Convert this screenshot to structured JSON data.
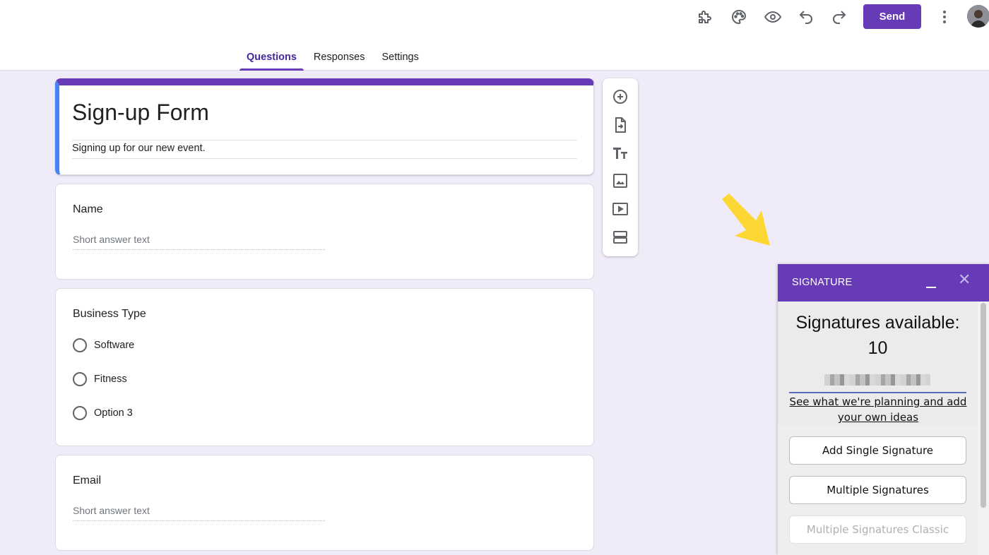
{
  "header": {
    "icons": [
      "addons-icon",
      "palette-icon",
      "preview-eye-icon",
      "undo-icon",
      "redo-icon",
      "more-vert-icon"
    ],
    "send_label": "Send"
  },
  "tabs": [
    {
      "label": "Questions",
      "active": true
    },
    {
      "label": "Responses",
      "active": false
    },
    {
      "label": "Settings",
      "active": false
    }
  ],
  "form": {
    "title": "Sign-up Form",
    "description": "Signing up for our new event.",
    "accent_color": "#673ab7",
    "questions": [
      {
        "title": "Name",
        "placeholder": "Short answer text"
      },
      {
        "title": "Business Type",
        "options": [
          "Software",
          "Fitness",
          "Option 3"
        ]
      },
      {
        "title": "Email",
        "placeholder": "Short answer text"
      }
    ]
  },
  "side_toolbar": {
    "icons": [
      "add-question-icon",
      "import-questions-icon",
      "add-title-icon",
      "add-image-icon",
      "add-video-icon",
      "add-section-icon"
    ]
  },
  "signature_panel": {
    "title": "SIGNATURE",
    "available_label": "Signatures available:",
    "available_count": "10",
    "link_text": "See what we're planning and add your own ideas",
    "buttons": [
      "Add Single Signature",
      "Multiple Signatures",
      "Multiple Signatures Classic"
    ]
  }
}
